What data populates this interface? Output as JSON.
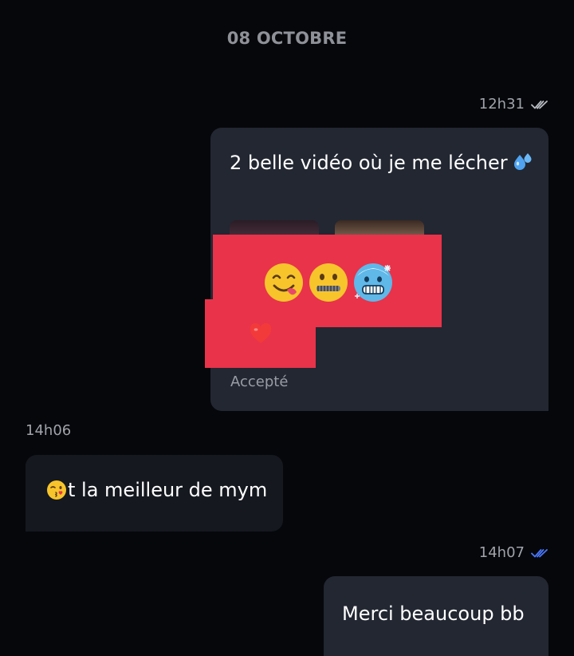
{
  "date_separator": "08 OCTOBRE",
  "messages": [
    {
      "time": "12h31",
      "read_icon": "double-check-icon",
      "read_color": "#b8bbc2",
      "text": "2 belle vidéo où je me lécher",
      "trailing_icon": "sweat-droplets-icon",
      "reactions": [
        "yum-face-icon",
        "zipper-mouth-face-icon",
        "cold-face-icon",
        "red-heart-icon"
      ],
      "status": "Accepté"
    },
    {
      "time": "14h06",
      "leading_icon": "face-blowing-kiss-icon",
      "text": "t la meilleur de mym"
    },
    {
      "time": "14h07",
      "read_icon": "double-check-icon",
      "read_color": "#4a78ff",
      "text": "Merci beaucoup bb"
    }
  ],
  "colors": {
    "background": "#06070b",
    "outgoing_bubble": "#222732",
    "incoming_bubble": "#15181f",
    "redaction": "#e8334a"
  }
}
